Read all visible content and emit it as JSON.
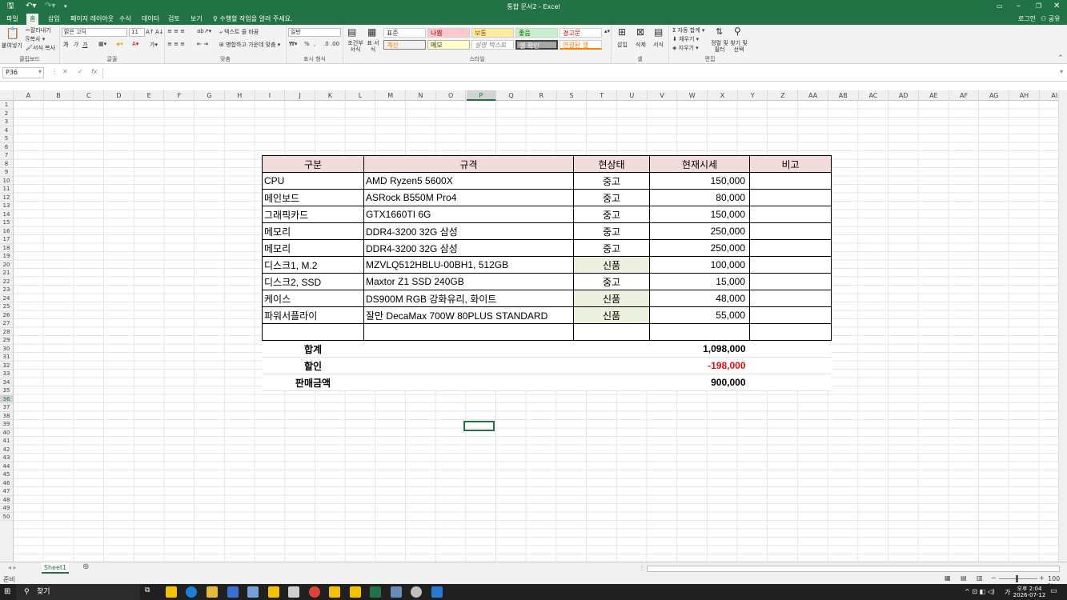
{
  "window": {
    "title": "통합 문서2 - Excel"
  },
  "menu": {
    "tabs": [
      "파일",
      "홈",
      "삽입",
      "페이지 레이아웃",
      "수식",
      "데이터",
      "검토",
      "보기"
    ],
    "tellme": "수행할 작업을 알려 주세요.",
    "login": "로그인",
    "share": "공유"
  },
  "ribbon": {
    "clipboard": {
      "paste": "붙여넣기",
      "cut": "잘라내기",
      "copy": "복사",
      "format_painter": "서식 복사",
      "label": "클립보드"
    },
    "font": {
      "name": "맑은 고딕",
      "size": "11",
      "bold": "가",
      "italic": "가",
      "underline": "가",
      "label": "글꼴"
    },
    "align": {
      "wrap": "텍스트 줄 바꿈",
      "merge": "병합하고 가운데 맞춤",
      "label": "맞춤"
    },
    "number": {
      "format": "일반",
      "percent": "%",
      "label": "표시 형식"
    },
    "styles": {
      "cond": "조건부 서식",
      "table": "표 서식",
      "cells": [
        "표준",
        "나쁨",
        "보통",
        "좋음",
        "경고문",
        "계산",
        "메모",
        "설명 텍스트",
        "셀 확인",
        "연결된 셀"
      ],
      "label": "스타일"
    },
    "cells_grp": {
      "insert": "삽입",
      "delete": "삭제",
      "format": "서식",
      "label": "셀"
    },
    "edit": {
      "autosum": "자동 합계",
      "fill": "채우기",
      "clear": "지우기",
      "sort": "정렬 및 필터",
      "find": "찾기 및 선택",
      "label": "편집"
    }
  },
  "formula_bar": {
    "name_box": "P36",
    "fx": "fx",
    "value": ""
  },
  "columns": [
    "A",
    "B",
    "C",
    "D",
    "E",
    "F",
    "G",
    "H",
    "I",
    "J",
    "K",
    "L",
    "M",
    "N",
    "O",
    "P",
    "Q",
    "R",
    "S",
    "T",
    "U",
    "V",
    "W",
    "X",
    "Y",
    "Z",
    "AA",
    "AB",
    "AC",
    "AD",
    "AE",
    "AF",
    "AG",
    "AH",
    "AI"
  ],
  "rows": [
    "1",
    "2",
    "3",
    "4",
    "5",
    "6",
    "7",
    "8",
    "9",
    "10",
    "11",
    "12",
    "13",
    "14",
    "15",
    "16",
    "17",
    "18",
    "19",
    "20",
    "21",
    "22",
    "23",
    "24",
    "25",
    "26",
    "27",
    "28",
    "29",
    "30",
    "31",
    "32",
    "33",
    "34",
    "35",
    "36",
    "37",
    "38",
    "39",
    "40",
    "41",
    "42",
    "43",
    "44",
    "45",
    "46",
    "47",
    "48",
    "49",
    "50"
  ],
  "table": {
    "headers": [
      "구분",
      "규격",
      "현상태",
      "현재시세",
      "비고"
    ],
    "rows": [
      {
        "cat": "CPU",
        "spec": "AMD Ryzen5 5600X",
        "state": "중고",
        "price": "150,000",
        "note": "",
        "new": false
      },
      {
        "cat": "메인보드",
        "spec": "ASRock B550M Pro4",
        "state": "중고",
        "price": "80,000",
        "note": "",
        "new": false
      },
      {
        "cat": "그래픽카드",
        "spec": "GTX1660TI 6G",
        "state": "중고",
        "price": "150,000",
        "note": "",
        "new": false
      },
      {
        "cat": "메모리",
        "spec": "DDR4-3200 32G 삼성",
        "state": "중고",
        "price": "250,000",
        "note": "",
        "new": false
      },
      {
        "cat": "메모리",
        "spec": "DDR4-3200 32G 삼성",
        "state": "중고",
        "price": "250,000",
        "note": "",
        "new": false
      },
      {
        "cat": "디스크1, M.2",
        "spec": "MZVLQ512HBLU-00BH1, 512GB",
        "state": "신품",
        "price": "100,000",
        "note": "",
        "new": true
      },
      {
        "cat": "디스크2, SSD",
        "spec": "Maxtor Z1 SSD 240GB",
        "state": "중고",
        "price": "15,000",
        "note": "",
        "new": false
      },
      {
        "cat": "케이스",
        "spec": "DS900M RGB 강화유리, 화이트",
        "state": "신품",
        "price": "48,000",
        "note": "",
        "new": true
      },
      {
        "cat": "파워서플라이",
        "spec": "잘만 DecaMax 700W 80PLUS STANDARD",
        "state": "신품",
        "price": "55,000",
        "note": "",
        "new": true
      },
      {
        "cat": "",
        "spec": "",
        "state": "",
        "price": "",
        "note": "",
        "new": false
      }
    ],
    "summary": [
      {
        "label": "합계",
        "value": "1,098,000",
        "red": false
      },
      {
        "label": "할인",
        "value": "-198,000",
        "red": true
      },
      {
        "label": "판매금액",
        "value": "900,000",
        "red": false
      }
    ]
  },
  "sheets": [
    "Sheet1"
  ],
  "status": {
    "ready": "준비",
    "zoom": "100 %"
  },
  "taskbar": {
    "search": "찾기",
    "time": "오후 2:04",
    "date": "2026-07-12",
    "lang": "가"
  }
}
